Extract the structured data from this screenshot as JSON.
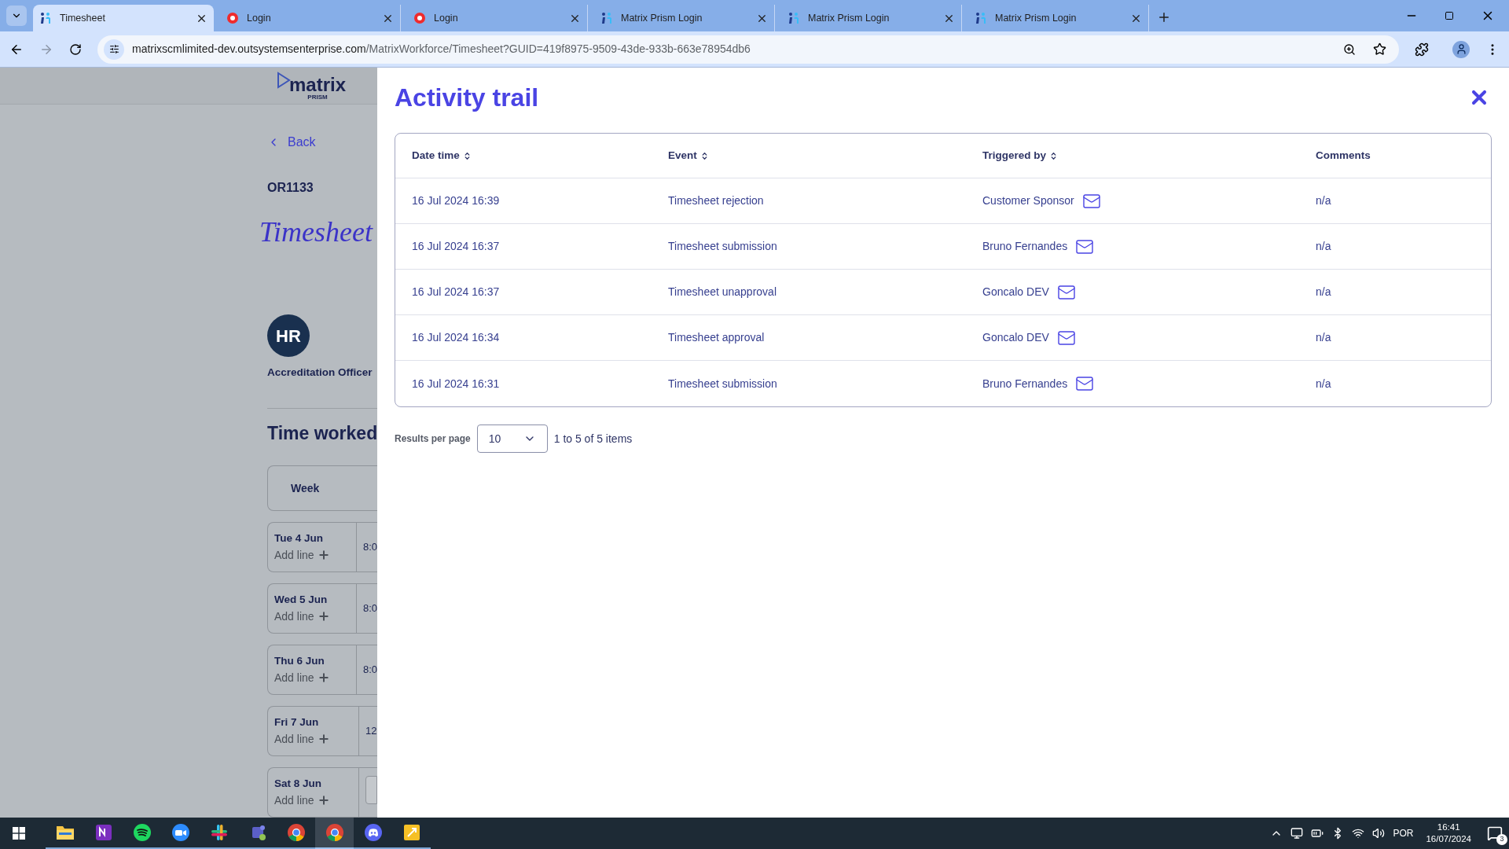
{
  "browser": {
    "tabs": [
      {
        "title": "Timesheet",
        "selected": true
      },
      {
        "title": "Login",
        "selected": false
      },
      {
        "title": "Login",
        "selected": false
      },
      {
        "title": "Matrix Prism Login",
        "selected": false
      },
      {
        "title": "Matrix Prism Login",
        "selected": false
      },
      {
        "title": "Matrix Prism Login",
        "selected": false
      }
    ],
    "url": {
      "host": "matrixscmlimited-dev.outsystemsenterprise.com",
      "path": "/MatrixWorkforce/Timesheet?GUID=419f8975-9509-43de-933b-663e78954db6"
    }
  },
  "page": {
    "logo": {
      "name": "matrix",
      "sub": "PRISM"
    },
    "back": "Back",
    "reference": "OR1133",
    "title": "Timesheet",
    "avatar": "HR",
    "role": "Accreditation Officer",
    "section": "Time worked",
    "week_header": "Week",
    "days": [
      {
        "day": "Tue 4 Jun",
        "action": "Add line",
        "time": "8:0",
        "kind": "text"
      },
      {
        "day": "Wed 5 Jun",
        "action": "Add line",
        "time": "8:0",
        "kind": "text"
      },
      {
        "day": "Thu 6 Jun",
        "action": "Add line",
        "time": "8:0",
        "kind": "text"
      },
      {
        "day": "Fri 7 Jun",
        "action": "Add line",
        "time": "12",
        "kind": "text"
      },
      {
        "day": "Sat 8 Jun",
        "action": "Add line",
        "kind": "input"
      }
    ]
  },
  "panel": {
    "title": "Activity trail",
    "columns": [
      {
        "label": "Date time",
        "sortable": true
      },
      {
        "label": "Event",
        "sortable": true
      },
      {
        "label": "Triggered by",
        "sortable": true
      },
      {
        "label": "Comments",
        "sortable": false
      }
    ],
    "rows": [
      {
        "date_time": "16 Jul 2024 16:39",
        "event": "Timesheet rejection",
        "triggered_by": "Customer Sponsor",
        "comments": "n/a"
      },
      {
        "date_time": "16 Jul 2024 16:37",
        "event": "Timesheet submission",
        "triggered_by": "Bruno Fernandes",
        "comments": "n/a"
      },
      {
        "date_time": "16 Jul 2024 16:37",
        "event": "Timesheet unapproval",
        "triggered_by": "Goncalo DEV",
        "comments": "n/a"
      },
      {
        "date_time": "16 Jul 2024 16:34",
        "event": "Timesheet approval",
        "triggered_by": "Goncalo DEV",
        "comments": "n/a"
      },
      {
        "date_time": "16 Jul 2024 16:31",
        "event": "Timesheet submission",
        "triggered_by": "Bruno Fernandes",
        "comments": "n/a"
      }
    ],
    "pagination": {
      "label": "Results per page",
      "value": "10",
      "summary": "1 to 5 of 5 items"
    }
  },
  "taskbar": {
    "apps": [
      {
        "kind": "explorer",
        "selected": false
      },
      {
        "kind": "onenote",
        "selected": false
      },
      {
        "kind": "spotify",
        "selected": false
      },
      {
        "kind": "zoom",
        "selected": false
      },
      {
        "kind": "slack",
        "selected": false
      },
      {
        "kind": "teams",
        "selected": false
      },
      {
        "kind": "chrome",
        "selected": false
      },
      {
        "kind": "chrome",
        "selected": true
      },
      {
        "kind": "discord",
        "selected": false
      },
      {
        "kind": "yellow",
        "selected": false
      }
    ],
    "language": "POR",
    "time": "16:41",
    "date": "16/07/2024",
    "notifications": "3"
  }
}
